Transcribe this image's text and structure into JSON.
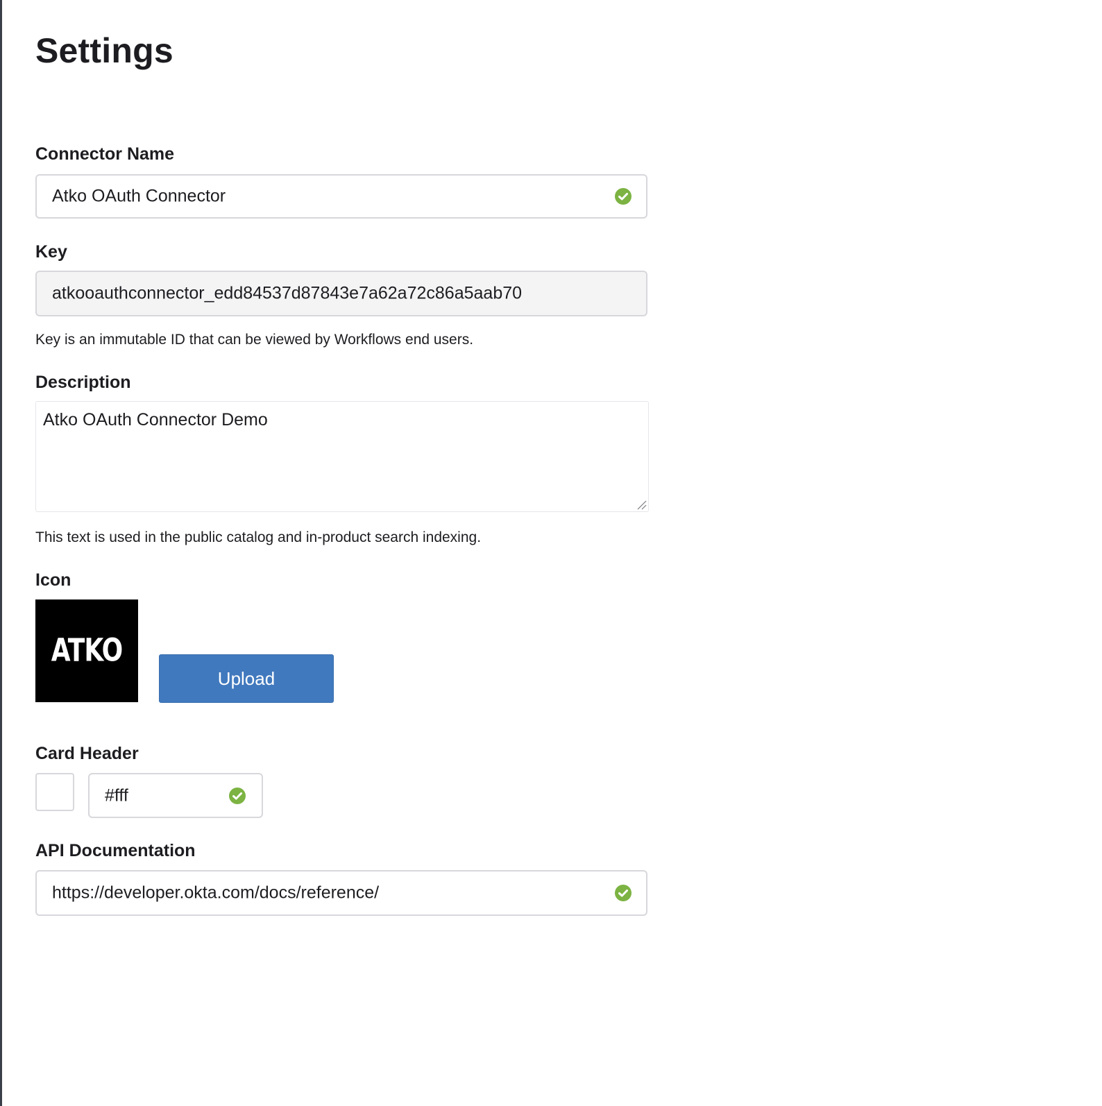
{
  "page": {
    "title": "Settings"
  },
  "connector_name": {
    "label": "Connector Name",
    "value": "Atko OAuth Connector",
    "status_icon": "check-circle-icon"
  },
  "key": {
    "label": "Key",
    "value": "atkooauthconnector_edd84537d87843e7a62a72c86a5aab70",
    "hint": "Key is an immutable ID that can be viewed by Workflows end users."
  },
  "description": {
    "label": "Description",
    "value": "Atko OAuth Connector Demo",
    "hint": "This text is used in the public catalog and in-product search indexing."
  },
  "icon": {
    "label": "Icon",
    "logo_text": "ATKO",
    "upload_label": "Upload"
  },
  "card_header": {
    "label": "Card Header",
    "value": "#fff",
    "swatch_color": "#ffffff",
    "status_icon": "check-circle-icon"
  },
  "api_documentation": {
    "label": "API Documentation",
    "value": "https://developer.okta.com/docs/reference/",
    "status_icon": "check-circle-icon"
  },
  "colors": {
    "accent": "#4179be",
    "valid": "#7cb342"
  }
}
